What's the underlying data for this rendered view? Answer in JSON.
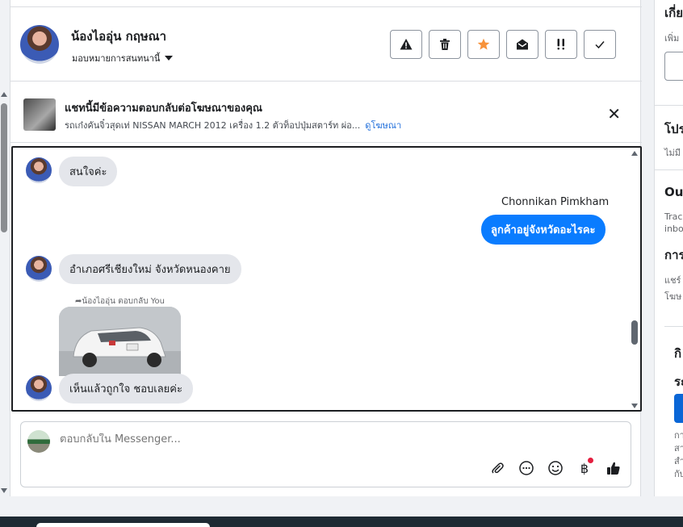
{
  "header": {
    "contact_name": "น้องไออุ่น กฤษณา",
    "assign_label": "มอบหมายการสนทนานี้",
    "actions": [
      {
        "name": "spam-button",
        "icon": "warning-icon"
      },
      {
        "name": "delete-button",
        "icon": "trash-icon"
      },
      {
        "name": "star-button",
        "icon": "star-icon"
      },
      {
        "name": "mark-unread-button",
        "icon": "envelope-open-icon"
      },
      {
        "name": "follow-up-button",
        "icon": "exclamation-icon"
      },
      {
        "name": "mark-done-button",
        "icon": "check-icon"
      }
    ]
  },
  "ad_banner": {
    "title": "แชทนี้มีข้อความตอบกลับต่อโฆษณาของคุณ",
    "description": "รถเก๋งคันจิ๋วสุดเท่ NISSAN MARCH 2012 เครื่อง 1.2 ตัวท็อปปุ่มสตาร์ท ผ่อ...",
    "link_label": "ดูโฆษณา"
  },
  "messages": {
    "m1": "สนใจค่ะ",
    "sender_name": "Chonnikan Pimkham",
    "m2": "ลูกค้าอยู่จังหวัดอะไรคะ",
    "m3": "อำเภอศรีเชียงใหม่ จังหวัดหนองคาย",
    "replied_label": "น้องไออุ่น ตอบกลับ You",
    "m4": "เห็นแล้วถูกใจ ชอบเลยค่ะ"
  },
  "composer": {
    "placeholder": "ตอบกลับใน Messenger...",
    "icons": [
      "attachment-icon",
      "saved-reply-icon",
      "emoji-icon",
      "baht-icon",
      "thumbs-up-icon"
    ]
  },
  "right_panel": {
    "t1": "เกี่ย",
    "s1": "เพิ่ม",
    "t2": "โปร",
    "s2": "ไม่มี",
    "t3": "Out",
    "s3a": "Track",
    "s3b": "inbo",
    "t4": "การ",
    "s4a": "แชร์",
    "s4b": "โฆษ",
    "t5": "กิ",
    "t6": "ระ",
    "s6a": "กา",
    "s6b": "สา",
    "s6c": "สำ",
    "s6d": "กับ"
  },
  "colors": {
    "accent": "#0a7cff",
    "link": "#216fdb",
    "star": "#f7923a",
    "notify": "#e41e3f"
  }
}
